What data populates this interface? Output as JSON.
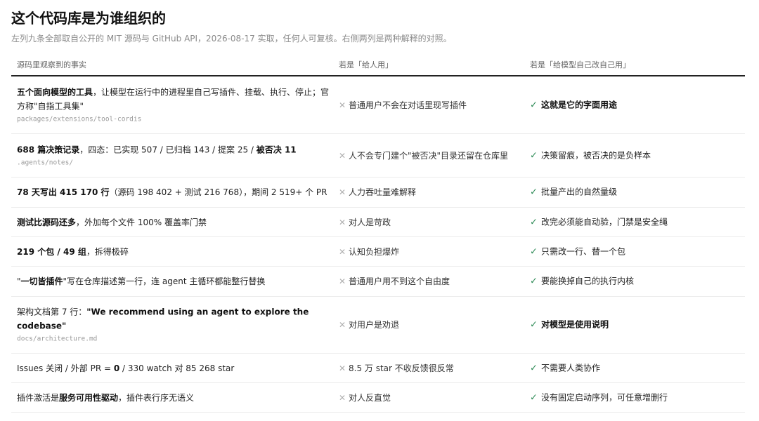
{
  "title": "这个代码库是为谁组织的",
  "subtitle": "左列九条全部取自公开的 MIT 源码与 GitHub API，2026-08-17 实取，任何人可复核。右侧两列是两种解释的对照。",
  "headers": {
    "fact": "源码里观察到的事实",
    "human": "若是「给人用」",
    "model": "若是「给模型自己改自己用」"
  },
  "rows": [
    {
      "fact": [
        {
          "t": "五个面向模型的工具",
          "b": true
        },
        {
          "t": "，让模型在运行中的进程里自己写插件、挂载、执行、停止；官方称\"自指工具集\"",
          "b": false
        }
      ],
      "path": "packages/extensions/tool-cordis",
      "human": "普通用户不会在对话里现写插件",
      "model": "这就是它的字面用途",
      "model_bold": true
    },
    {
      "fact": [
        {
          "t": "688 篇决策记录",
          "b": true
        },
        {
          "t": "，四态：已实现 507 / 已归档 143 / 提案 25 / ",
          "b": false
        },
        {
          "t": "被否决 11",
          "b": true
        }
      ],
      "path": ".agents/notes/",
      "human": "人不会专门建个\"被否决\"目录还留在仓库里",
      "model": "决策留痕，被否决的是负样本",
      "model_bold": false
    },
    {
      "fact": [
        {
          "t": "78 天写出 415 170 行",
          "b": true
        },
        {
          "t": "（源码 198 402 + 测试 216 768），期间 2 519+ 个 PR",
          "b": false
        }
      ],
      "path": "",
      "human": "人力吞吐量难解释",
      "model": "批量产出的自然量级",
      "model_bold": false
    },
    {
      "fact": [
        {
          "t": "测试比源码还多",
          "b": true
        },
        {
          "t": "，外加每个文件 100% 覆盖率门禁",
          "b": false
        }
      ],
      "path": "",
      "human": "对人是苛政",
      "model": "改完必须能自动验，门禁是安全绳",
      "model_bold": false
    },
    {
      "fact": [
        {
          "t": "219 个包 / 49 组",
          "b": true
        },
        {
          "t": "，拆得极碎",
          "b": false
        }
      ],
      "path": "",
      "human": "认知负担爆炸",
      "model": "只需改一行、替一个包",
      "model_bold": false
    },
    {
      "fact": [
        {
          "t": "\"",
          "b": false
        },
        {
          "t": "一切皆插件",
          "b": true
        },
        {
          "t": "\"写在仓库描述第一行，连 agent 主循环都能整行替换",
          "b": false
        }
      ],
      "path": "",
      "human": "普通用户用不到这个自由度",
      "model": "要能换掉自己的执行内核",
      "model_bold": false
    },
    {
      "fact": [
        {
          "t": "架构文档第 7 行：",
          "b": false
        },
        {
          "t": "\"We recommend using an agent to explore the codebase\"",
          "b": true
        }
      ],
      "path": "docs/architecture.md",
      "human": "对用户是劝退",
      "model": "对模型是使用说明",
      "model_bold": true
    },
    {
      "fact": [
        {
          "t": "Issues 关闭 / 外部 PR = ",
          "b": false
        },
        {
          "t": "0",
          "b": true
        },
        {
          "t": " / 330 watch 对 85 268 star",
          "b": false
        }
      ],
      "path": "",
      "human": "8.5 万 star 不收反馈很反常",
      "model": "不需要人类协作",
      "model_bold": false
    },
    {
      "fact": [
        {
          "t": "插件激活是",
          "b": false
        },
        {
          "t": "服务可用性驱动",
          "b": true
        },
        {
          "t": "，插件表行序无语义",
          "b": false
        }
      ],
      "path": "",
      "human": "对人反直觉",
      "model": "没有固定启动序列，可任意增删行",
      "model_bold": false
    }
  ],
  "icons": {
    "negative": "cross-icon",
    "positive": "check-icon"
  },
  "colors": {
    "check": "#2e8b57",
    "cross": "#b0b0b0",
    "rule": "#222222"
  }
}
